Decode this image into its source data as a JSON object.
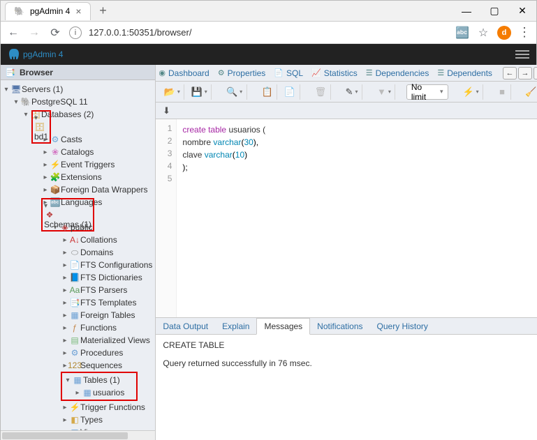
{
  "window": {
    "tab_title": "pgAdmin 4",
    "url": "127.0.0.1:50351/browser/",
    "avatar_initial": "d"
  },
  "header": {
    "brand": "pgAdmin 4"
  },
  "sidebar": {
    "title": "Browser",
    "tree": {
      "servers": "Servers (1)",
      "pg11": "PostgreSQL 11",
      "databases": "Databases (2)",
      "bd1": "bd1",
      "casts": "Casts",
      "catalogs": "Catalogs",
      "event_triggers": "Event Triggers",
      "extensions": "Extensions",
      "fdw": "Foreign Data Wrappers",
      "languages": "Languages",
      "schemas": "Schemas (1)",
      "public": "public",
      "collations": "Collations",
      "domains": "Domains",
      "fts_conf": "FTS Configurations",
      "fts_dict": "FTS Dictionaries",
      "fts_pars": "FTS Parsers",
      "fts_tmpl": "FTS Templates",
      "foreign_tables": "Foreign Tables",
      "functions": "Functions",
      "mat_views": "Materialized Views",
      "procedures": "Procedures",
      "sequences": "Sequences",
      "tables": "Tables (1)",
      "usuarios": "usuarios",
      "trigger_fn": "Trigger Functions",
      "types": "Types",
      "views": "Views"
    }
  },
  "tabs": {
    "dashboard": "Dashboard",
    "properties": "Properties",
    "sql": "SQL",
    "statistics": "Statistics",
    "dependencies": "Dependencies",
    "dependents": "Dependents"
  },
  "toolbar": {
    "nolimit": "No limit"
  },
  "editor": {
    "lines": {
      "l1a": "create table ",
      "l1b": "usuarios (",
      "l2a": "  nombre ",
      "l2b": "varchar",
      "l2c": "(",
      "l2d": "30",
      "l2e": "),",
      "l3a": "  clave ",
      "l3b": "varchar",
      "l3c": "(",
      "l3d": "10",
      "l3e": ")",
      "l4": ");"
    }
  },
  "result_tabs": {
    "data_output": "Data Output",
    "explain": "Explain",
    "messages": "Messages",
    "notifications": "Notifications",
    "query_history": "Query History"
  },
  "messages": {
    "line1": "CREATE TABLE",
    "line2": "Query returned successfully in 76 msec."
  }
}
